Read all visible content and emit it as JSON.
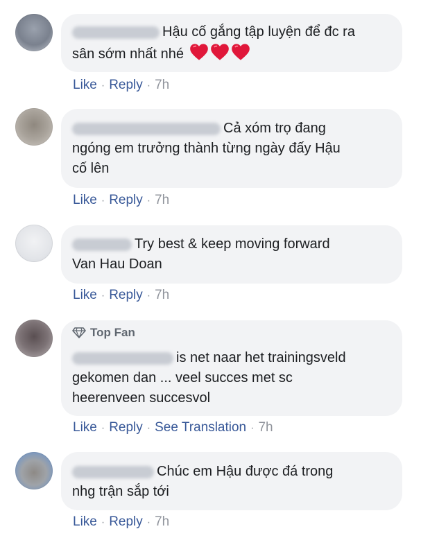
{
  "comments": [
    {
      "lines": [
        "Hậu cố gắng tập luyện để đc ra",
        "sân sớm nhất nhé"
      ],
      "emoji": "heart-icon",
      "hearts": 3,
      "actions": {
        "like": "Like",
        "reply": "Reply",
        "time": "7h"
      }
    },
    {
      "lines": [
        "Cả xóm trọ đang",
        "ngóng em trưởng thành từng ngày đấy Hậu",
        "cố lên"
      ],
      "actions": {
        "like": "Like",
        "reply": "Reply",
        "time": "7h"
      }
    },
    {
      "lines": [
        "Try best & keep moving forward",
        "Van Hau Doan"
      ],
      "actions": {
        "like": "Like",
        "reply": "Reply",
        "time": "7h"
      }
    },
    {
      "badge": "Top Fan",
      "lines": [
        "is net naar het trainingsveld",
        "gekomen dan ... veel succes met sc",
        "heerenveen succesvol"
      ],
      "actions": {
        "like": "Like",
        "reply": "Reply",
        "translate": "See Translation",
        "time": "7h"
      }
    },
    {
      "lines": [
        "Chúc em Hậu được đá trong",
        "nhg trận sắp tới"
      ],
      "actions": {
        "like": "Like",
        "reply": "Reply",
        "time": "7h"
      }
    }
  ],
  "separator": "·",
  "colors": {
    "link": "#385898",
    "bubble": "#f2f3f5",
    "text": "#1c1e21",
    "meta": "#90949c",
    "heart": "#e0173a"
  }
}
